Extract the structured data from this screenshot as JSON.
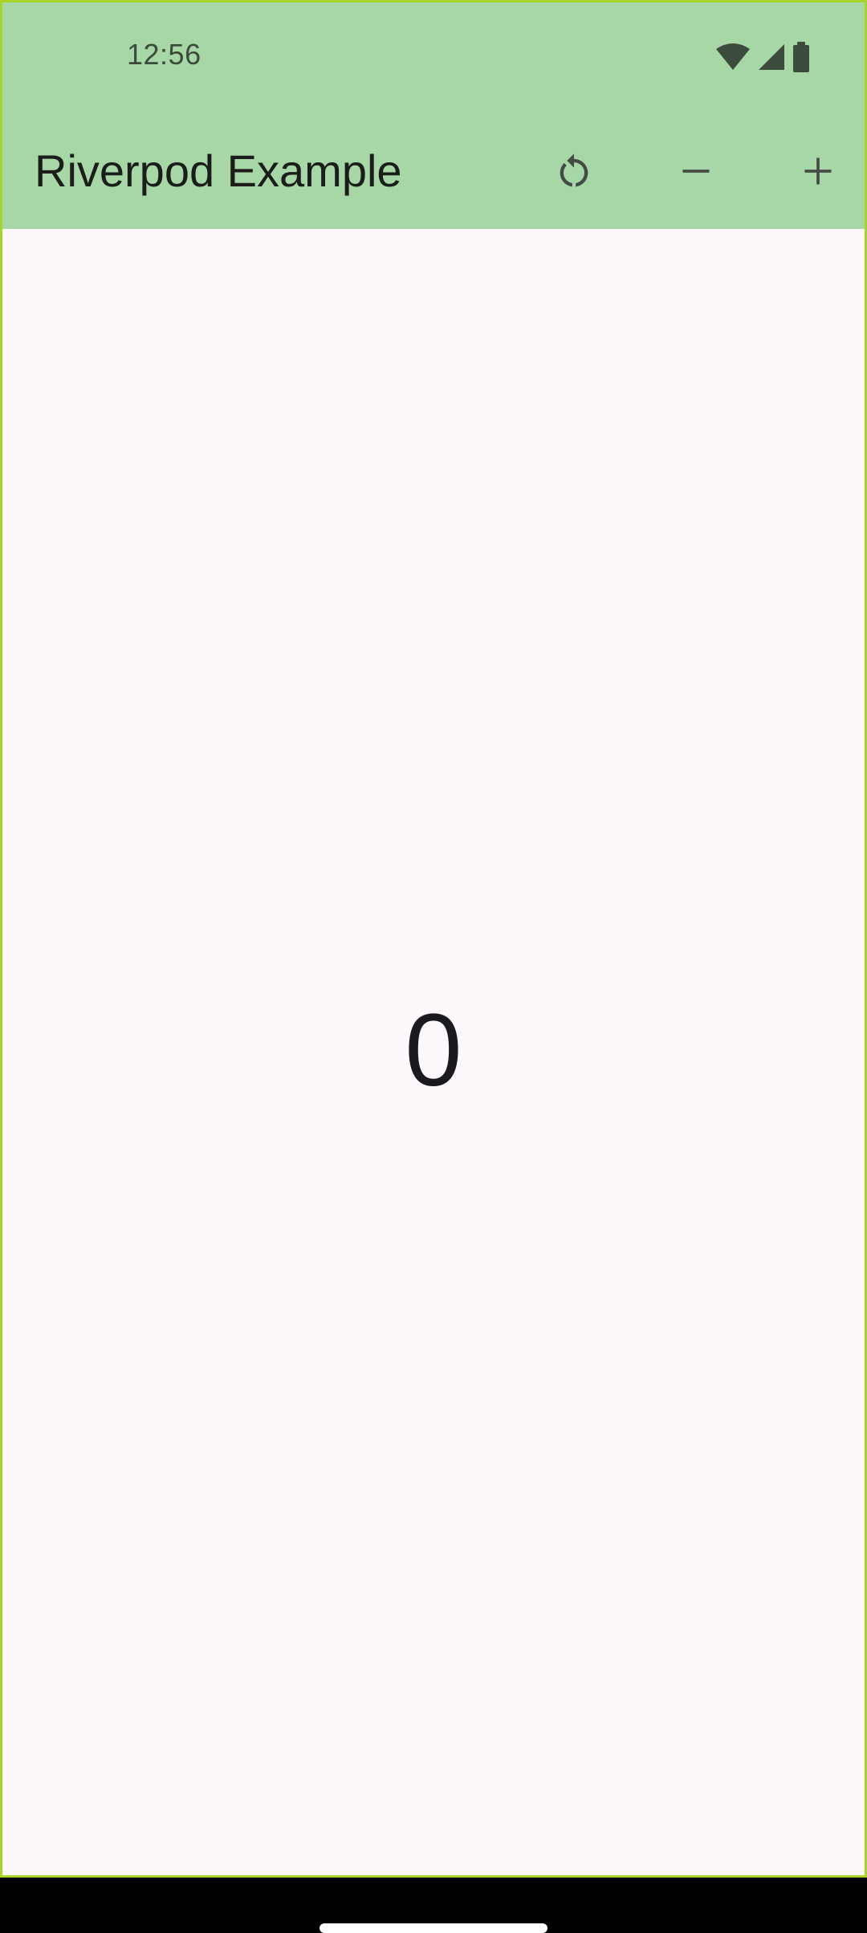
{
  "status_bar": {
    "time": "12:56",
    "icons": [
      "wifi-icon",
      "cellular-signal-icon",
      "battery-icon"
    ]
  },
  "app_bar": {
    "title": "Riverpod Example",
    "actions": [
      {
        "name": "reset",
        "icon": "refresh-icon"
      },
      {
        "name": "decrement",
        "icon": "minus-icon"
      },
      {
        "name": "increment",
        "icon": "plus-icon"
      }
    ]
  },
  "main": {
    "counter_value": "0"
  },
  "colors": {
    "app_bar_bg": "#a7d7a7",
    "body_bg": "#fdf8fc",
    "icon_color": "#444a44",
    "text_color": "#1b1b1f"
  }
}
